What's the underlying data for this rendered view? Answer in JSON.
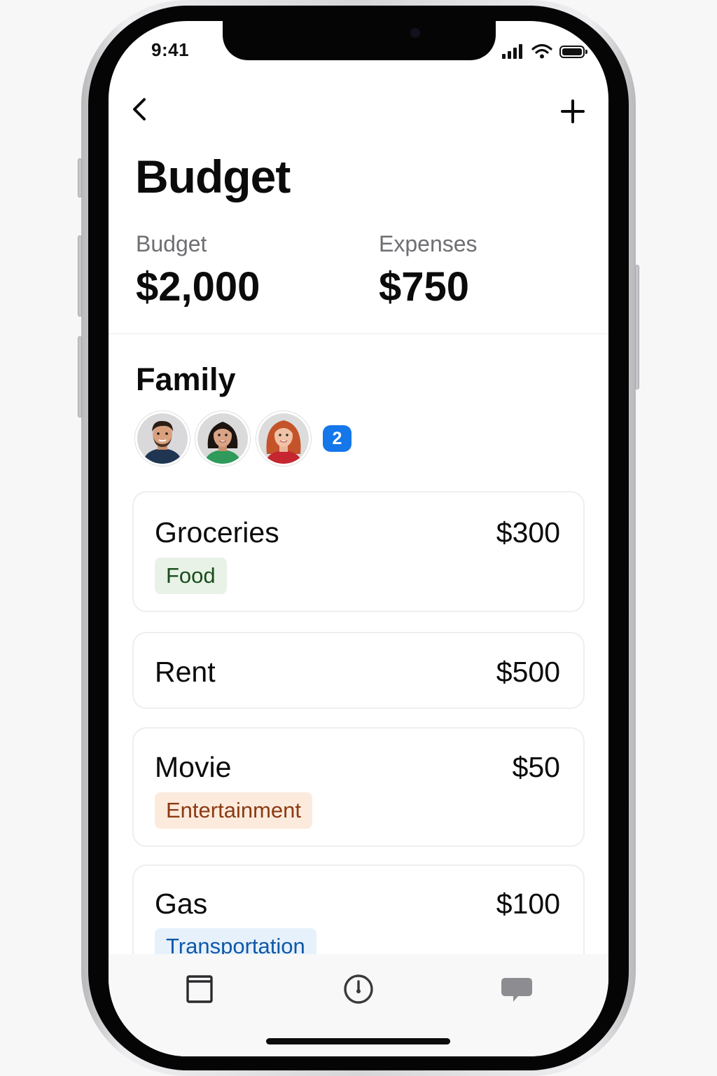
{
  "status_bar": {
    "time": "9:41"
  },
  "nav": {
    "back_icon": "chevron-left-icon",
    "add_icon": "plus-icon"
  },
  "page_title": "Budget",
  "summary": {
    "budget_label": "Budget",
    "budget_value": "$2,000",
    "expenses_label": "Expenses",
    "expenses_value": "$750"
  },
  "family": {
    "title": "Family",
    "members": [
      {
        "name": "member-1"
      },
      {
        "name": "member-2"
      },
      {
        "name": "member-3"
      }
    ],
    "extra_count": "2"
  },
  "expenses": [
    {
      "name": "Groceries",
      "amount": "$300",
      "tag": "Food",
      "tag_color": "#1a4d1f"
    },
    {
      "name": "Rent",
      "amount": "$500"
    },
    {
      "name": "Movie",
      "amount": "$50",
      "tag": "Entertainment",
      "tag_color": "#8c3a12"
    },
    {
      "name": "Gas",
      "amount": "$100",
      "tag": "Transportation",
      "tag_color": "#0f58a8"
    }
  ],
  "tab_bar": {
    "items": [
      {
        "icon": "calendar-icon"
      },
      {
        "icon": "clock-icon"
      },
      {
        "icon": "chat-bubble-icon"
      }
    ]
  },
  "colors": {
    "accent": "#1577ea",
    "text": "#0b0b0b",
    "secondary_text": "#6e6e73"
  }
}
